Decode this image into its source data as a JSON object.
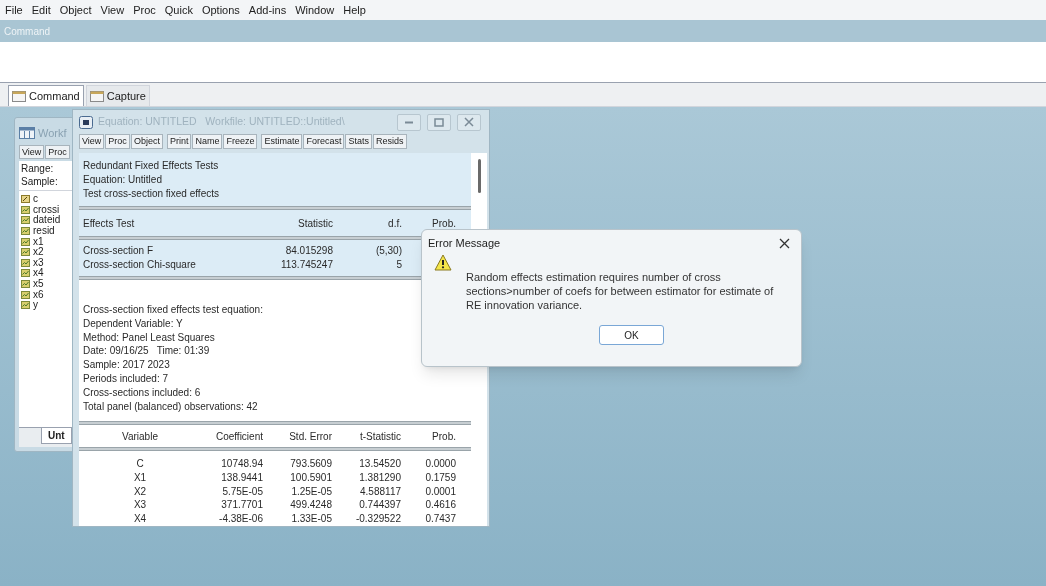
{
  "menu_bar": [
    "File",
    "Edit",
    "Object",
    "View",
    "Proc",
    "Quick",
    "Options",
    "Add-ins",
    "Window",
    "Help"
  ],
  "command_window": {
    "title": "Command"
  },
  "tabs": [
    {
      "label": "Command",
      "selected": true
    },
    {
      "label": "Capture",
      "selected": false
    }
  ],
  "workfile_window": {
    "title": "Workf",
    "toolbar": [
      "View",
      "Proc"
    ],
    "info": [
      "Range:",
      "Sample:"
    ],
    "objects": [
      {
        "name": "c",
        "kind": "coef"
      },
      {
        "name": "crossi",
        "kind": "series"
      },
      {
        "name": "dateid",
        "kind": "series"
      },
      {
        "name": "resid",
        "kind": "series"
      },
      {
        "name": "x1",
        "kind": "series"
      },
      {
        "name": "x2",
        "kind": "series"
      },
      {
        "name": "x3",
        "kind": "series"
      },
      {
        "name": "x4",
        "kind": "series"
      },
      {
        "name": "x5",
        "kind": "series"
      },
      {
        "name": "x6",
        "kind": "series"
      },
      {
        "name": "y",
        "kind": "series"
      }
    ],
    "page_tab": "Unt"
  },
  "equation_window": {
    "title": "Equation: UNTITLED   Workfile: UNTITLED::Untitled\\",
    "toolbar": [
      [
        "View",
        "Proc",
        "Object"
      ],
      [
        "Print",
        "Name",
        "Freeze"
      ],
      [
        "Estimate",
        "Forecast",
        "Stats",
        "Resids"
      ]
    ],
    "header_lines": [
      "Redundant Fixed Effects Tests",
      "Equation: Untitled",
      "Test cross-section fixed effects"
    ],
    "effects_table": {
      "columns": [
        "Effects Test",
        "Statistic",
        "d.f.",
        "Prob."
      ],
      "rows": [
        [
          "Cross-section F",
          "84.015298",
          "(5,30)"
        ],
        [
          "Cross-section Chi-square",
          "113.745247",
          "5"
        ]
      ]
    },
    "test_lines": [
      "Cross-section fixed effects test equation:",
      "Dependent Variable: Y",
      "Method: Panel Least Squares",
      "Date: 09/16/25   Time: 01:39",
      "Sample: 2017 2023",
      "Periods included: 7",
      "Cross-sections included: 6",
      "Total panel (balanced) observations: 42"
    ],
    "coef_table": {
      "columns": [
        "Variable",
        "Coefficient",
        "Std. Error",
        "t-Statistic",
        "Prob."
      ],
      "rows": [
        [
          "C",
          "10748.94",
          "793.5609",
          "13.54520",
          "0.0000"
        ],
        [
          "X1",
          "138.9441",
          "100.5901",
          "1.381290",
          "0.1759"
        ],
        [
          "X2",
          "5.75E-05",
          "1.25E-05",
          "4.588117",
          "0.0001"
        ],
        [
          "X3",
          "371.7701",
          "499.4248",
          "0.744397",
          "0.4616"
        ],
        [
          "X4",
          "-4.38E-06",
          "1.33E-05",
          "-0.329522",
          "0.7437"
        ]
      ]
    }
  },
  "dialog": {
    "title": "Error Message",
    "message": "Random effects estimation requires number of cross sections>number of coefs for between estimator for estimate of RE innovation variance.",
    "button": "OK"
  }
}
